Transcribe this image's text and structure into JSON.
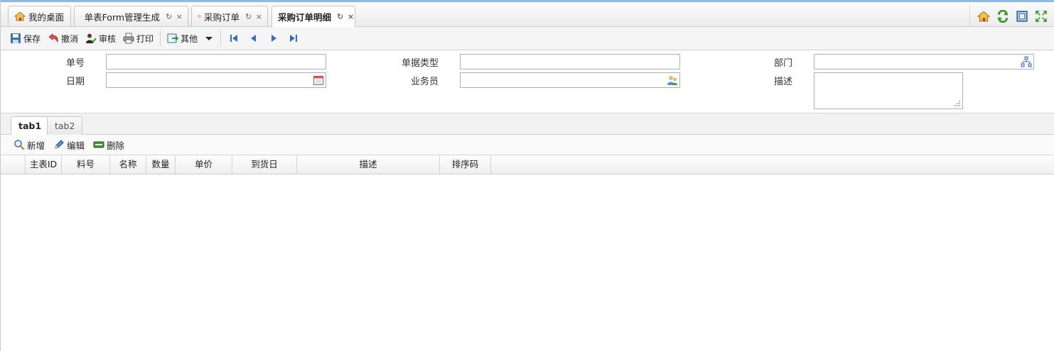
{
  "tabs": [
    {
      "label": "我的桌面",
      "icon": "home-icon",
      "closable": false
    },
    {
      "label": "单表Form管理生成",
      "icon": "flower-icon",
      "closable": true
    },
    {
      "label": "采购订单",
      "icon": "gear-flower-icon",
      "closable": true
    },
    {
      "label": "采购订单明细",
      "icon": "",
      "closable": true,
      "active": true
    }
  ],
  "tab_controls": "↻ ×",
  "tab_tools": [
    "home-icon",
    "refresh-icon",
    "restore-window-icon",
    "fullscreen-icon"
  ],
  "toolbar": {
    "save": "保存",
    "cancel": "撤消",
    "audit": "审核",
    "print": "打印",
    "other": "其他"
  },
  "form": {
    "order_no": {
      "label": "单号",
      "value": ""
    },
    "doc_type": {
      "label": "单据类型",
      "value": ""
    },
    "department": {
      "label": "部门",
      "value": ""
    },
    "date": {
      "label": "日期",
      "value": ""
    },
    "salesman": {
      "label": "业务员",
      "value": ""
    },
    "description": {
      "label": "描述",
      "value": ""
    }
  },
  "inner_tabs": [
    "tab1",
    "tab2"
  ],
  "grid_toolbar": {
    "add": "新增",
    "edit": "编辑",
    "delete": "删除"
  },
  "grid": {
    "columns": [
      "主表ID",
      "料号",
      "名称",
      "数量",
      "单价",
      "到货日",
      "描述",
      "排序码"
    ],
    "rows": []
  },
  "colors": {
    "accent_border": "#8fb8de",
    "nav_arrow": "#2a6fc9"
  }
}
